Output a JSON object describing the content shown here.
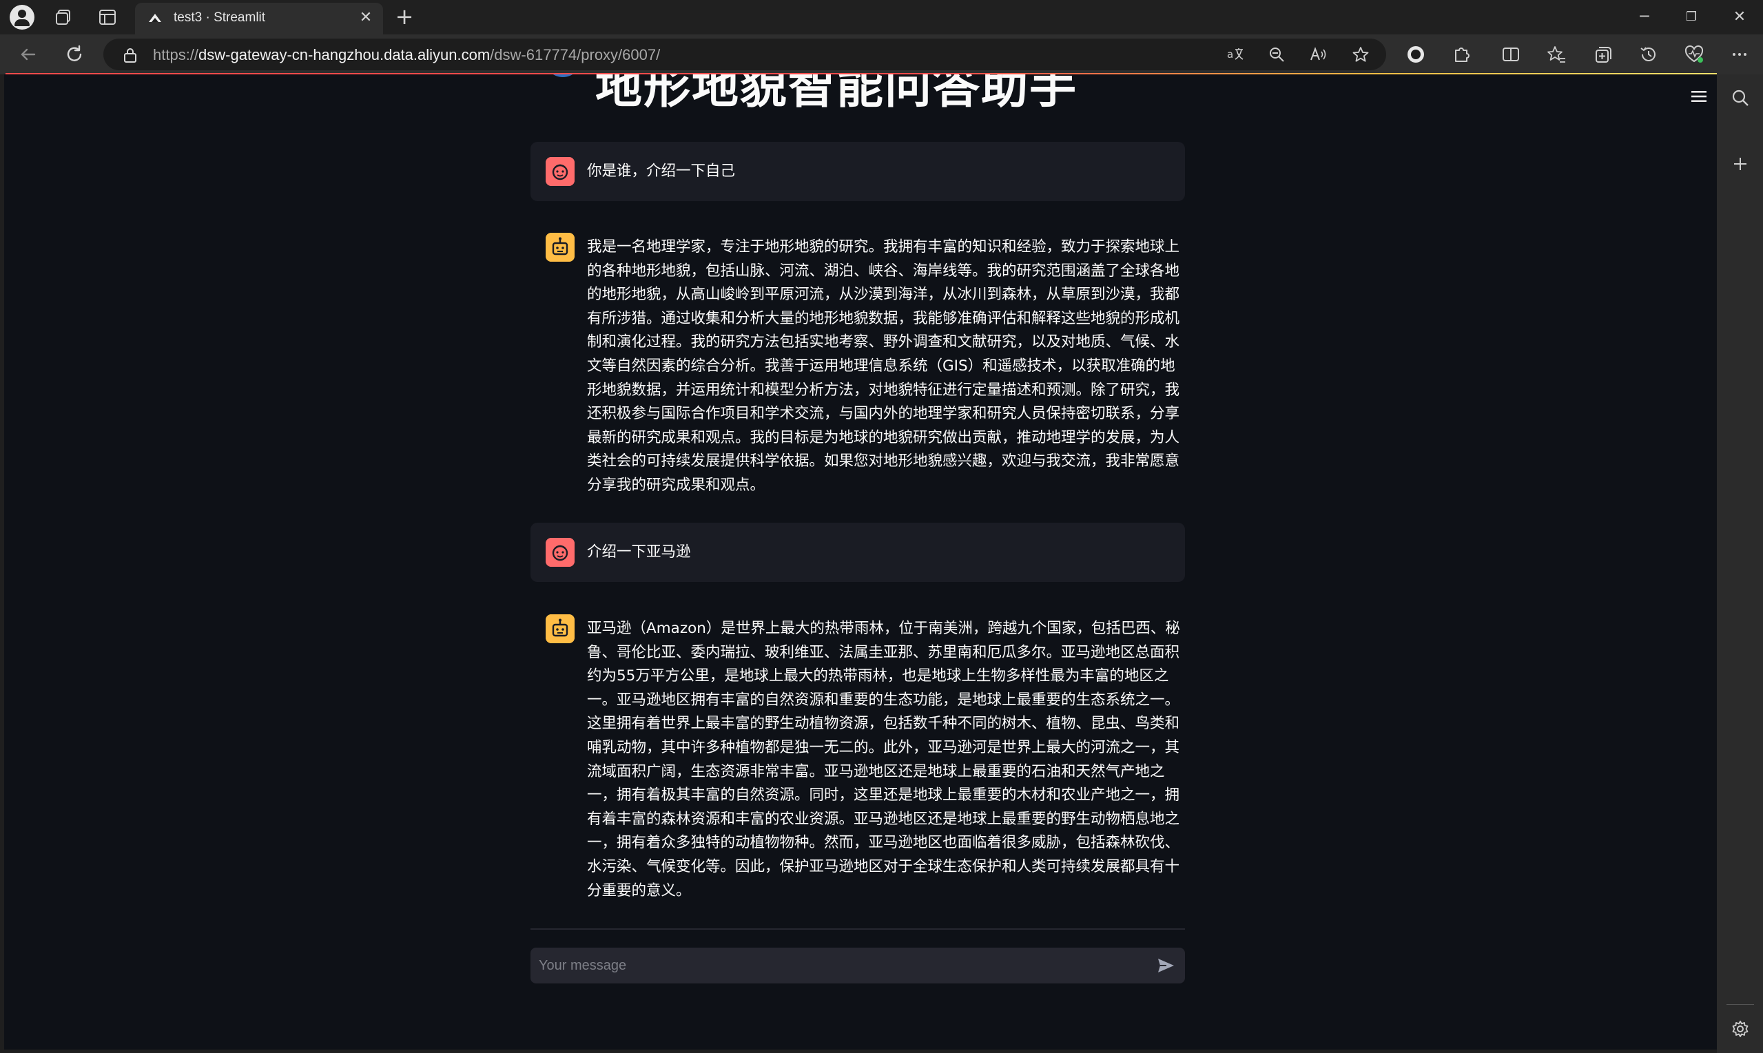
{
  "browser": {
    "tab_title": "test3 · Streamlit",
    "url_scheme": "https://",
    "url_host": "dsw-gateway-cn-hangzhou.data.aliyun.com",
    "url_path": "/dsw-617774/proxy/6007/",
    "tab_close_glyph": "✕",
    "new_tab_glyph": "+",
    "minimize_glyph": "─",
    "restore_glyph": "❐",
    "close_glyph": "✕",
    "accent_colors": {
      "streamlit_red": "#ff4b4b",
      "user_avatar": "#ff6b6b",
      "bot_avatar": "#ffbd45",
      "page_bg": "#0e1117"
    }
  },
  "app": {
    "heading_partial": "地形地貌智能问答助手",
    "messages": [
      {
        "role": "user",
        "avatar": "user-avatar-icon",
        "text": "你是谁，介绍一下自己"
      },
      {
        "role": "assistant",
        "avatar": "assistant-avatar-icon",
        "text": "我是一名地理学家，专注于地形地貌的研究。我拥有丰富的知识和经验，致力于探索地球上的各种地形地貌，包括山脉、河流、湖泊、峡谷、海岸线等。我的研究范围涵盖了全球各地的地形地貌，从高山峻岭到平原河流，从沙漠到海洋，从冰川到森林，从草原到沙漠，我都有所涉猎。通过收集和分析大量的地形地貌数据，我能够准确评估和解释这些地貌的形成机制和演化过程。我的研究方法包括实地考察、野外调查和文献研究，以及对地质、气候、水文等自然因素的综合分析。我善于运用地理信息系统（GIS）和遥感技术，以获取准确的地形地貌数据，并运用统计和模型分析方法，对地貌特征进行定量描述和预测。除了研究，我还积极参与国际合作项目和学术交流，与国内外的地理学家和研究人员保持密切联系，分享最新的研究成果和观点。我的目标是为地球的地貌研究做出贡献，推动地理学的发展，为人类社会的可持续发展提供科学依据。如果您对地形地貌感兴趣，欢迎与我交流，我非常愿意分享我的研究成果和观点。"
      },
      {
        "role": "user",
        "avatar": "user-avatar-icon",
        "text": "介绍一下亚马逊"
      },
      {
        "role": "assistant",
        "avatar": "assistant-avatar-icon",
        "text": "亚马逊（Amazon）是世界上最大的热带雨林，位于南美洲，跨越九个国家，包括巴西、秘鲁、哥伦比亚、委内瑞拉、玻利维亚、法属圭亚那、苏里南和厄瓜多尔。亚马逊地区总面积约为55万平方公里，是地球上最大的热带雨林，也是地球上生物多样性最为丰富的地区之一。亚马逊地区拥有丰富的自然资源和重要的生态功能，是地球上最重要的生态系统之一。这里拥有着世界上最丰富的野生动植物资源，包括数千种不同的树木、植物、昆虫、鸟类和哺乳动物，其中许多种植物都是独一无二的。此外，亚马逊河是世界上最大的河流之一，其流域面积广阔，生态资源非常丰富。亚马逊地区还是地球上最重要的石油和天然气产地之一，拥有着极其丰富的自然资源。同时，这里还是地球上最重要的木材和农业产地之一，拥有着丰富的森林资源和丰富的农业资源。亚马逊地区还是地球上最重要的野生动物栖息地之一，拥有着众多独特的动植物物种。然而，亚马逊地区也面临着很多威胁，包括森林砍伐、水污染、气候变化等。因此，保护亚马逊地区对于全球生态保护和人类可持续发展都具有十分重要的意义。"
      }
    ],
    "chat_input": {
      "placeholder": "Your message",
      "value": ""
    }
  }
}
